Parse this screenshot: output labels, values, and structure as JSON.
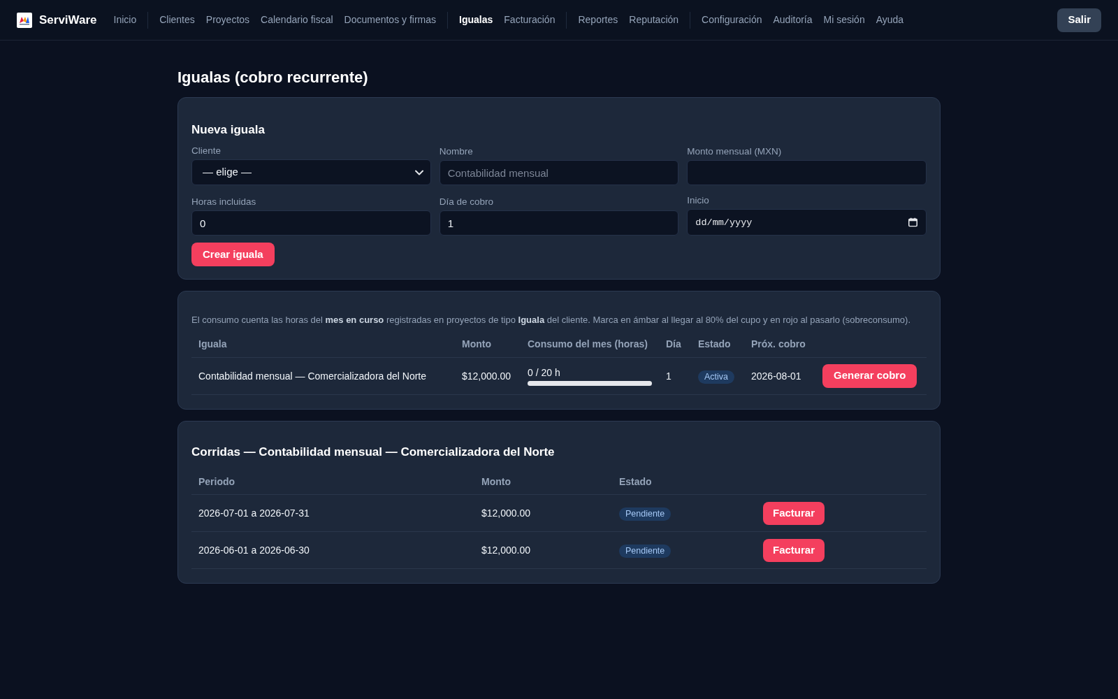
{
  "nav": {
    "brand": "ServiWare",
    "groups": [
      {
        "items": [
          {
            "label": "Inicio",
            "selected": false
          }
        ]
      },
      {
        "items": [
          {
            "label": "Clientes",
            "selected": false
          },
          {
            "label": "Proyectos",
            "selected": false
          },
          {
            "label": "Calendario fiscal",
            "selected": false
          },
          {
            "label": "Documentos y firmas",
            "selected": false
          }
        ]
      },
      {
        "items": [
          {
            "label": "Igualas",
            "selected": true
          },
          {
            "label": "Facturación",
            "selected": false
          }
        ]
      },
      {
        "items": [
          {
            "label": "Reportes",
            "selected": false
          },
          {
            "label": "Reputación",
            "selected": false
          }
        ]
      },
      {
        "items": [
          {
            "label": "Configuración",
            "selected": false
          },
          {
            "label": "Auditoría",
            "selected": false
          },
          {
            "label": "Mi sesión",
            "selected": false
          },
          {
            "label": "Ayuda",
            "selected": false
          }
        ]
      }
    ],
    "logout": "Salir"
  },
  "page_title": "Igualas (cobro recurrente)",
  "new_form": {
    "title": "Nueva iguala",
    "fields": [
      {
        "kind": "select",
        "label": "Cliente",
        "value": "— elige —"
      },
      {
        "kind": "text",
        "label": "Nombre",
        "placeholder": "Contabilidad mensual"
      },
      {
        "kind": "text",
        "label": "Monto mensual (MXN)"
      },
      {
        "kind": "text",
        "label": "Horas incluidas",
        "value": "0"
      },
      {
        "kind": "text",
        "label": "Día de cobro",
        "value": "1"
      },
      {
        "kind": "date",
        "label": "Inicio",
        "placeholder": "dd/mm/yyyy"
      }
    ],
    "submit": "Crear iguala"
  },
  "igualas": {
    "note": "El consumo cuenta las horas del **mes en curso** registradas en proyectos de tipo **Iguala** del cliente. Marca en ámbar al llegar al 80% del cupo y en rojo al pasarlo (sobreconsumo).",
    "columns": [
      "Iguala",
      "Monto",
      "Consumo del mes (horas)",
      "Día",
      "Estado",
      "Próx. cobro"
    ],
    "rows": [
      {
        "name": "Contabilidad mensual — Comercializadora del Norte",
        "amount": "$12,000.00",
        "usage": {
          "reading": "0 / 20 h",
          "level": 0
        },
        "day": "1",
        "status": "Activa",
        "next_charge": "2026-08-01",
        "action": "Generar cobro"
      }
    ]
  },
  "runs": {
    "title": "Corridas — Contabilidad mensual — Comercializadora del Norte",
    "columns": [
      "Periodo",
      "Monto",
      "Estado"
    ],
    "rows": [
      {
        "period": "2026-07-01 a 2026-07-31",
        "amount": "$12,000.00",
        "status": "Pendiente",
        "action": "Facturar"
      },
      {
        "period": "2026-06-01 a 2026-06-30",
        "amount": "$12,000.00",
        "status": "Pendiente",
        "action": "Facturar"
      }
    ]
  }
}
